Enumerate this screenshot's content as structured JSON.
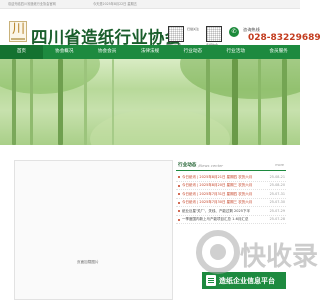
{
  "topbar": {
    "left_text": "欢迎光临四川省造纸行业协会官网",
    "right_text": "今天是2025年8月22日 星期五"
  },
  "header": {
    "logo_char": "川",
    "title": "四川省造纸行业协会",
    "qr1_caption": "微信公众号",
    "qr2_caption": "造纸协会",
    "qr_note": "扫描关注",
    "phone_label": "咨询热线",
    "phone_number": "028-83229689"
  },
  "nav": {
    "items": [
      "首页",
      "协会概况",
      "协会会员",
      "法律法规",
      "行业动态",
      "行业活动",
      "会员服务"
    ],
    "active_index": 0
  },
  "slideshow": {
    "placeholder": "页面加载图片"
  },
  "news": {
    "title": "行业动态",
    "subtitle": "/News center",
    "more_label": "more",
    "items": [
      {
        "title": "今日纸讯 | 2025年8月21日 星期四 农历六月",
        "date": "25-08-21",
        "highlight": true
      },
      {
        "title": "今日纸讯 | 2025年8月20日 星期三 农历六月",
        "date": "25-08-20",
        "highlight": true
      },
      {
        "title": "今日纸讯 | 2025年7月31日 星期四 农历六月",
        "date": "25-07-31",
        "highlight": true
      },
      {
        "title": "今日纸讯 | 2025年7月30日 星期三 农历六月",
        "date": "25-07-30",
        "highlight": true
      },
      {
        "title": "纸业巨星'关厂'、关线、产能过剩 2025下半",
        "date": "25-07-29",
        "highlight": false
      },
      {
        "title": "一季度国内新上马产能项目汇总 1-6月汇总",
        "date": "25-07-28",
        "highlight": false
      }
    ]
  },
  "platform_banner": {
    "label": "造纸企业信息平台"
  },
  "watermark": {
    "text": "快收录"
  },
  "colors": {
    "brand_green": "#1d8a3f",
    "nav_active": "#147230",
    "accent_red": "#c33c1f"
  }
}
